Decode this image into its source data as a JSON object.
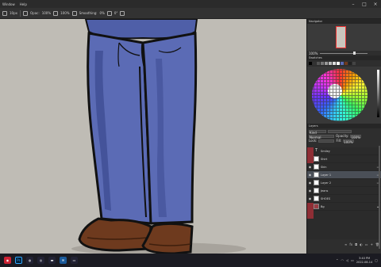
{
  "menubar": {
    "items": [
      "Window",
      "Help"
    ]
  },
  "optbar": {
    "size": "10px",
    "opacity_label": "Opac:",
    "opacity": "100%",
    "flow": "100%",
    "smoothing_label": "Smoothing:",
    "smoothing": "0%",
    "angle": "0°"
  },
  "panels": {
    "navigator": {
      "title": "Navigator",
      "zoom": "100%"
    },
    "swatches": {
      "title": "Swatches"
    },
    "layers": {
      "title": "Layers",
      "search_placeholder": "Kind",
      "blend_mode": "Normal",
      "opacity_label": "Opacity:",
      "opacity": "100%",
      "lock_label": "Lock:",
      "fill_label": "Fill:",
      "fill": "100%",
      "items": [
        {
          "name": "Smiley",
          "type": "text",
          "visible": true
        },
        {
          "name": "Shirt",
          "type": "raster",
          "visible": false
        },
        {
          "name": "Skin",
          "type": "raster",
          "visible": true
        },
        {
          "name": "Layer 1",
          "type": "raster",
          "visible": true,
          "active": true
        },
        {
          "name": "Layer 2",
          "type": "raster",
          "visible": true
        },
        {
          "name": "Jeans",
          "type": "raster",
          "visible": true
        },
        {
          "name": "SHOES",
          "type": "raster",
          "visible": true
        },
        {
          "name": "Bg",
          "type": "raster",
          "visible": true
        }
      ]
    }
  },
  "taskbar": {
    "time": "3:40 PM",
    "date": "2022-08-14",
    "pinned": [
      "windows-start",
      "photoshop",
      "edge",
      "chrome",
      "explorer",
      "mail",
      "store"
    ]
  },
  "colors": {
    "jeans": "#5b6bb5",
    "jeans_shadow": "#3f4d94",
    "shoes": "#6e3a1e",
    "canvas_bg": "#bfbcb5",
    "active_layer_red": "#8e2e35"
  }
}
